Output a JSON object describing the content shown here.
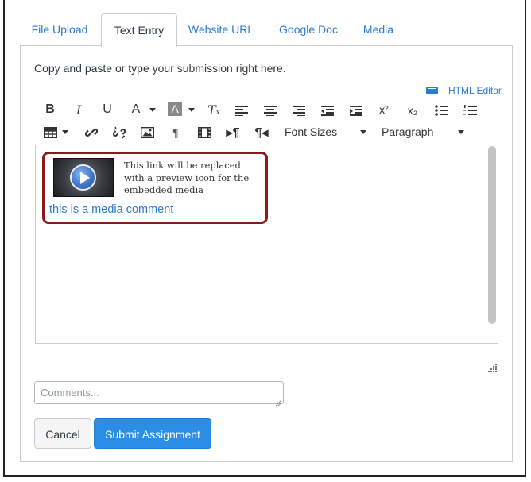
{
  "tabs": [
    {
      "label": "File Upload",
      "active": false
    },
    {
      "label": "Text Entry",
      "active": true
    },
    {
      "label": "Website URL",
      "active": false
    },
    {
      "label": "Google Doc",
      "active": false
    },
    {
      "label": "Media",
      "active": false
    }
  ],
  "instructions": "Copy and paste or type your submission right here.",
  "html_editor_label": "HTML Editor",
  "toolbar": {
    "font_sizes_label": "Font Sizes",
    "paragraph_label": "Paragraph",
    "superscript": "x²",
    "subscript": "x₂"
  },
  "editor": {
    "media_placeholder_note": "This link will be replaced with a preview icon for the embedded media",
    "media_comment_link": "this is a media comment"
  },
  "comments_placeholder": "Comments...",
  "buttons": {
    "cancel": "Cancel",
    "submit": "Submit Assignment"
  },
  "colors": {
    "accent": "#2d7bd2",
    "submit_bg": "#2a8ee6",
    "highlight_border": "#8b1a1a"
  }
}
